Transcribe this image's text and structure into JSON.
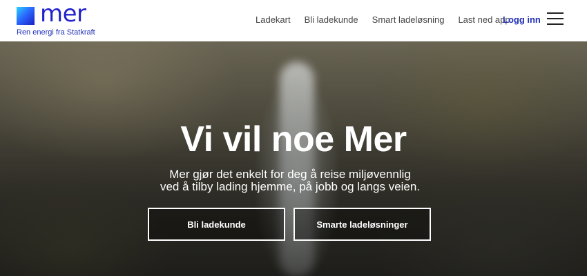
{
  "brand": {
    "name": "mer",
    "tagline": "Ren energi fra Statkraft"
  },
  "nav": {
    "items": [
      "Ladekart",
      "Bli ladekunde",
      "Smart ladeløsning",
      "Last ned app"
    ],
    "login": "Logg inn"
  },
  "hero": {
    "title": "Vi vil noe Mer",
    "subtitle_line1": "Mer gjør det enkelt for deg å reise miljøvennlig",
    "subtitle_line2": "ved å tilby lading hjemme, på jobb og langs veien.",
    "button_primary": "Bli ladekunde",
    "button_secondary": "Smarte ladeløsninger"
  },
  "colors": {
    "brand_blue": "#2222cc",
    "text_dark": "#444444"
  },
  "icons": {
    "menu": "hamburger-menu-icon",
    "logo": "mer-logo-square"
  }
}
